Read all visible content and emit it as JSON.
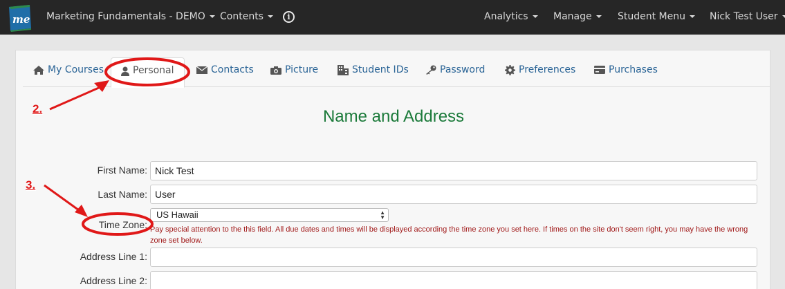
{
  "navbar": {
    "course_title": "Marketing Fundamentals - DEMO",
    "contents": "Contents",
    "analytics": "Analytics",
    "manage": "Manage",
    "student_menu": "Student Menu",
    "user_name": "Nick Test User",
    "bg_color": "#262626"
  },
  "tabs": {
    "my_courses": "My Courses",
    "personal": "Personal",
    "contacts": "Contacts",
    "picture": "Picture",
    "student_ids": "Student IDs",
    "password": "Password",
    "preferences": "Preferences",
    "purchases": "Purchases",
    "link_color": "#2a6496"
  },
  "section": {
    "title": "Name and Address",
    "title_color": "#1b7a3a"
  },
  "form": {
    "first_name_label": "First Name:",
    "first_name_value": "Nick Test",
    "last_name_label": "Last Name:",
    "last_name_value": "User",
    "time_zone_label": "Time Zone:",
    "time_zone_value": "US Hawaii",
    "time_zone_help": "Pay special attention to the this field. All due dates and times will be displayed according the time zone you set here. If times on the site don't seem right, you may have the wrong zone set below.",
    "address1_label": "Address Line 1:",
    "address1_value": "",
    "address2_label": "Address Line 2:",
    "address2_value": ""
  },
  "annotations": {
    "step2": "2.",
    "step3": "3.",
    "color": "#e01818"
  },
  "icons": [
    "home-icon",
    "user-icon",
    "envelope-icon",
    "camera-icon",
    "building-icon",
    "key-icon",
    "gear-icon",
    "credit-card-icon",
    "info-icon",
    "caret-down-icon"
  ]
}
